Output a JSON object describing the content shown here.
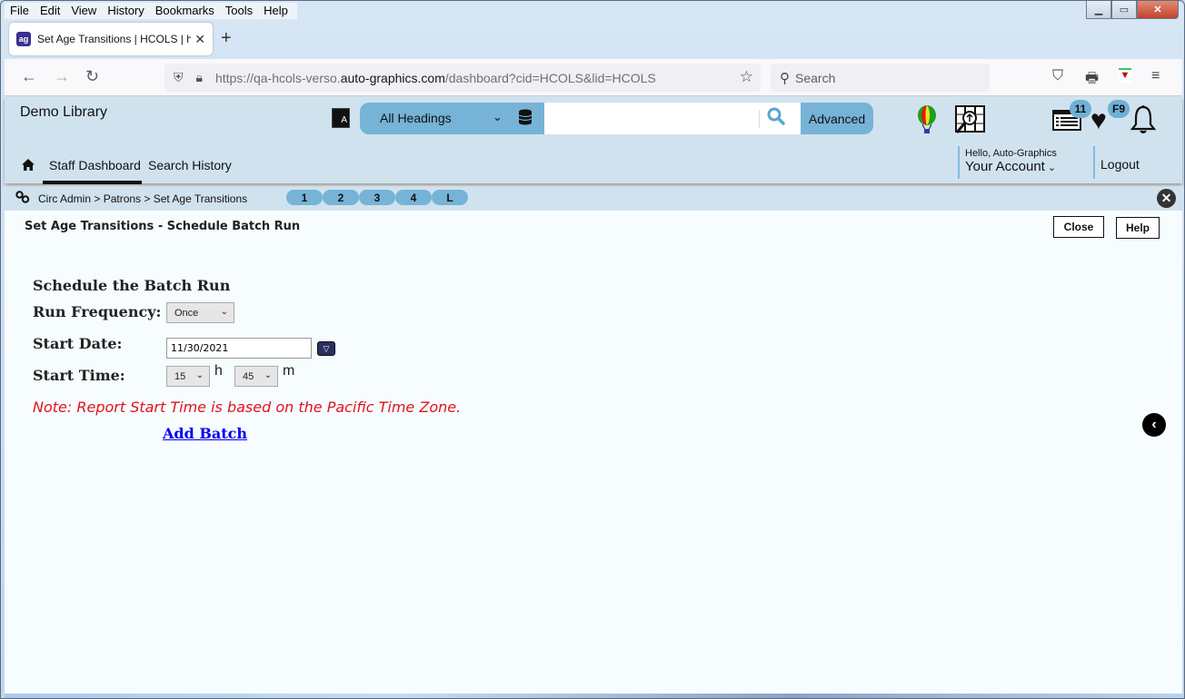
{
  "browser": {
    "menu": [
      "File",
      "Edit",
      "View",
      "History",
      "Bookmarks",
      "Tools",
      "Help"
    ],
    "tab": {
      "title": "Set Age Transitions | HCOLS | hc",
      "favicon": "ag"
    },
    "url": {
      "prefix": "https://qa-hcols-verso.",
      "domain": "auto-graphics.com",
      "path": "/dashboard?cid=HCOLS&lid=HCOLS"
    },
    "search_placeholder": "Search",
    "icons": {
      "back": "←",
      "forward": "→",
      "reload": "↻",
      "shield": "⛉",
      "lock": "🔒",
      "star": "☆",
      "pocket": "⛉",
      "print": "⎙",
      "menu": "≡"
    }
  },
  "app": {
    "library_name": "Demo Library",
    "search": {
      "scope": "All Headings",
      "query": "",
      "advanced_label": "Advanced"
    },
    "badges": {
      "list_count": "11",
      "favorites": "F9"
    },
    "nav": {
      "items": [
        "Staff Dashboard",
        "Search History"
      ]
    },
    "account": {
      "greeting": "Hello, Auto-Graphics",
      "label": "Your Account",
      "logout": "Logout"
    },
    "breadcrumb": {
      "path": "Circ Admin > Patrons > Set Age Transitions",
      "pills": [
        "1",
        "2",
        "3",
        "4",
        "L"
      ]
    }
  },
  "page": {
    "title": "Set Age Transitions - Schedule Batch Run",
    "close_label": "Close",
    "help_label": "Help",
    "form": {
      "heading": "Schedule the Batch Run",
      "run_frequency_label": "Run Frequency:",
      "run_frequency_value": "Once",
      "start_date_label": "Start Date:",
      "start_date_value": "11/30/2021",
      "start_time_label": "Start Time:",
      "hour_value": "15",
      "hour_unit": "h",
      "minute_value": "45",
      "minute_unit": "m",
      "note": "Note: Report Start Time is based on the Pacific Time Zone.",
      "add_batch_label": "Add Batch"
    }
  }
}
